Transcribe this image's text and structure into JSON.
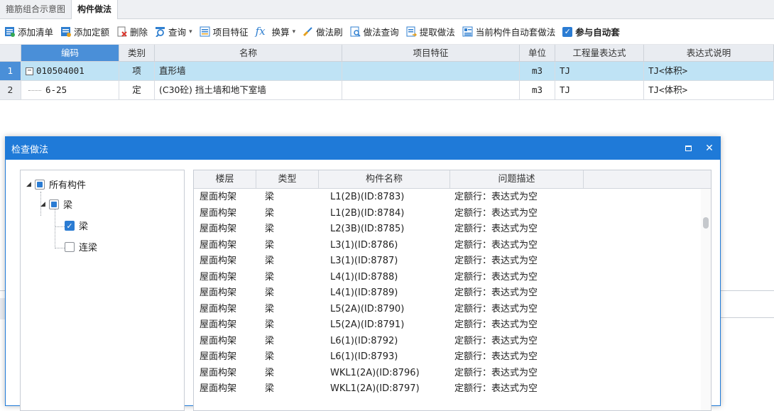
{
  "tabs": [
    "箍筋组合示意图",
    "构件做法"
  ],
  "toolbar": {
    "add_list": "添加清单",
    "add_quota": "添加定额",
    "delete": "删除",
    "query": "查询",
    "item_feature": "项目特征",
    "convert": "换算",
    "method_brush": "做法刷",
    "method_query": "做法查询",
    "extract_method": "提取做法",
    "auto_apply": "当前构件自动套做法",
    "participate_auto": "参与自动套"
  },
  "grid": {
    "headers": [
      "编码",
      "类别",
      "名称",
      "项目特征",
      "单位",
      "工程量表达式",
      "表达式说明"
    ],
    "rows": [
      {
        "idx": "1",
        "code": "010504001",
        "type": "项",
        "name": "直形墙",
        "feature": "",
        "unit": "m3",
        "expr": "TJ",
        "desc": "TJ<体积>"
      },
      {
        "idx": "2",
        "code": "6-25",
        "type": "定",
        "name": "(C30砼) 挡土墙和地下室墙",
        "feature": "",
        "unit": "m3",
        "expr": "TJ",
        "desc": "TJ<体积>"
      }
    ]
  },
  "dialog": {
    "title": "检查做法",
    "tree": {
      "root": "所有构件",
      "group": "梁",
      "children": [
        "梁",
        "连梁"
      ]
    },
    "list_headers": [
      "楼层",
      "类型",
      "构件名称",
      "问题描述"
    ],
    "rows": [
      {
        "floor": "屋面构架",
        "type": "梁",
        "name": "L1(2B)(ID:8783)",
        "problem": "定额行：表达式为空"
      },
      {
        "floor": "屋面构架",
        "type": "梁",
        "name": "L1(2B)(ID:8784)",
        "problem": "定额行：表达式为空"
      },
      {
        "floor": "屋面构架",
        "type": "梁",
        "name": "L2(3B)(ID:8785)",
        "problem": "定额行：表达式为空"
      },
      {
        "floor": "屋面构架",
        "type": "梁",
        "name": "L3(1)(ID:8786)",
        "problem": "定额行：表达式为空"
      },
      {
        "floor": "屋面构架",
        "type": "梁",
        "name": "L3(1)(ID:8787)",
        "problem": "定额行：表达式为空"
      },
      {
        "floor": "屋面构架",
        "type": "梁",
        "name": "L4(1)(ID:8788)",
        "problem": "定额行：表达式为空"
      },
      {
        "floor": "屋面构架",
        "type": "梁",
        "name": "L4(1)(ID:8789)",
        "problem": "定额行：表达式为空"
      },
      {
        "floor": "屋面构架",
        "type": "梁",
        "name": "L5(2A)(ID:8790)",
        "problem": "定额行：表达式为空"
      },
      {
        "floor": "屋面构架",
        "type": "梁",
        "name": "L5(2A)(ID:8791)",
        "problem": "定额行：表达式为空"
      },
      {
        "floor": "屋面构架",
        "type": "梁",
        "name": "L6(1)(ID:8792)",
        "problem": "定额行：表达式为空"
      },
      {
        "floor": "屋面构架",
        "type": "梁",
        "name": "L6(1)(ID:8793)",
        "problem": "定额行：表达式为空"
      },
      {
        "floor": "屋面构架",
        "type": "梁",
        "name": "WKL1(2A)(ID:8796)",
        "problem": "定额行：表达式为空"
      },
      {
        "floor": "屋面构架",
        "type": "梁",
        "name": "WKL1(2A)(ID:8797)",
        "problem": "定额行：表达式为空"
      }
    ]
  },
  "colors": {
    "accent": "#1f7ad8",
    "selected_row": "#bfe3f5",
    "header_selected": "#4a8fd8"
  }
}
